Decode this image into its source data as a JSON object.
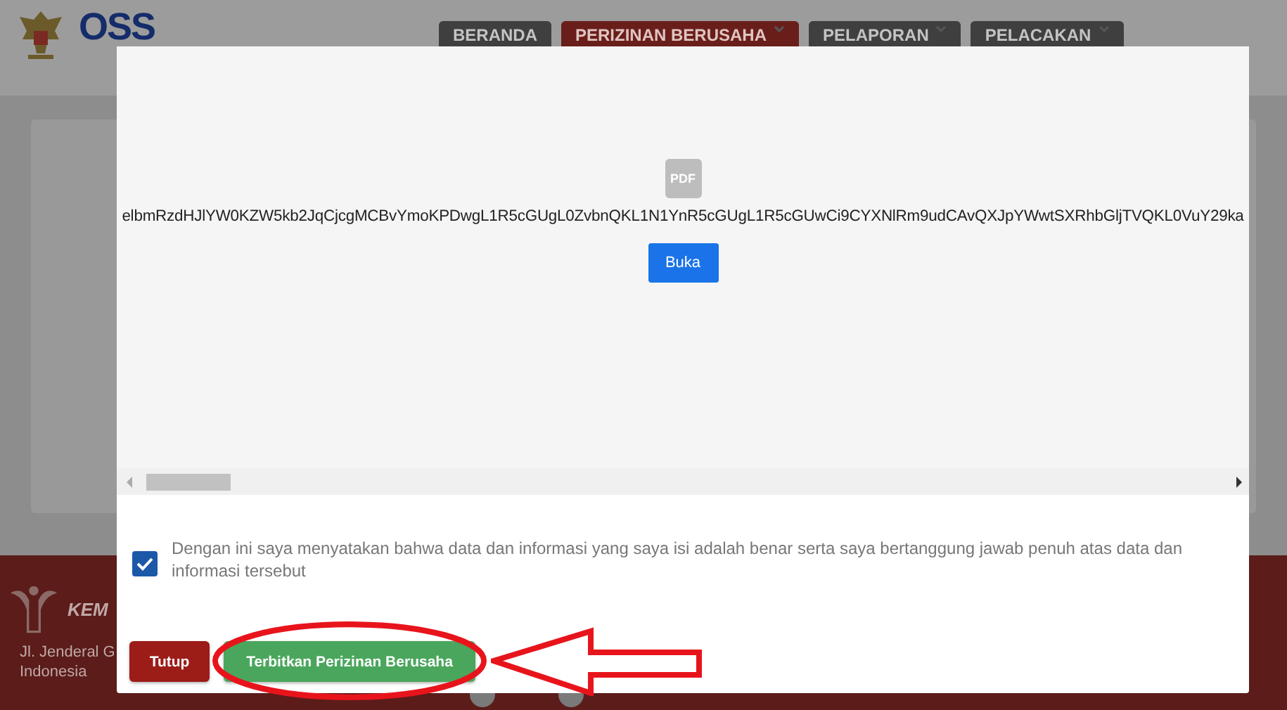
{
  "header": {
    "logo_text": "OSS",
    "nav": [
      {
        "label": "BERANDA",
        "selected": false,
        "dropdown": false
      },
      {
        "label": "PERIZINAN BERUSAHA",
        "selected": true,
        "dropdown": true
      },
      {
        "label": "PELAPORAN",
        "selected": false,
        "dropdown": true
      },
      {
        "label": "PELACAKAN",
        "selected": false,
        "dropdown": true
      }
    ]
  },
  "footer": {
    "title": "KEM",
    "address_lines": [
      "Jl. Jenderal G",
      "Indonesia"
    ]
  },
  "modal": {
    "pdf": {
      "icon_label": "PDF",
      "encoded_text": "elbmRzdHJlYW0KZW5kb2JqCjcgMCBvYmoKPDwgL1R5cGUgL0ZvbnQKL1N1YnR5cGUgL1R5cGUwCi9CYXNlRm9udCAvQXJpYWwtSXRhbGljTVQKL0VuY29ka",
      "open_button": "Buka"
    },
    "consent": {
      "checked": true,
      "text": "Dengan ini saya menyatakan bahwa data dan informasi yang saya isi adalah benar serta saya bertanggung jawab penuh atas data dan informasi tersebut"
    },
    "buttons": [
      {
        "label": "Tutup",
        "kind": "close",
        "highlighted": false
      },
      {
        "label": "Terbitkan Perizinan Berusaha",
        "kind": "primary",
        "highlighted": true
      }
    ]
  }
}
